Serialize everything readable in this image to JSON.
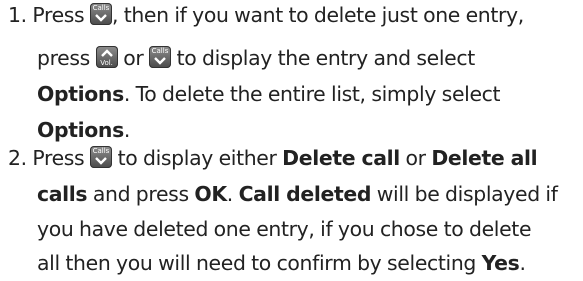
{
  "step1": {
    "number": "1.",
    "line1_a": " Press ",
    "line1_b": ", then if you want to delete just one entry,",
    "line2_a": "press ",
    "line2_b": " or ",
    "line2_c": " to display the entry and select",
    "line3_bold": "Options",
    "line3_rest": ". To delete the entire list, simply select",
    "line4_bold": "Options",
    "line4_rest": "."
  },
  "step2": {
    "number": "2.",
    "line1_a": " Press ",
    "line1_b": " to display either ",
    "line1_bold1": "Delete call",
    "line1_or": " or ",
    "line1_bold2": "Delete all",
    "line2_bold1": "calls",
    "line2_mid": " and press ",
    "line2_bold2": "OK",
    "line2_dot": ". ",
    "line2_bold3": "Call deleted",
    "line2_rest": " will be displayed if",
    "line3": "you have deleted one entry, if you chose to delete",
    "line4_a": "all then you will need to confirm by selecting ",
    "line4_bold": "Yes",
    "line4_dot": "."
  },
  "keys": {
    "calls": "Calls",
    "vol": "Vol."
  },
  "icons": {
    "calls_key": "calls-down-key-icon",
    "vol_key": "vol-up-key-icon"
  }
}
